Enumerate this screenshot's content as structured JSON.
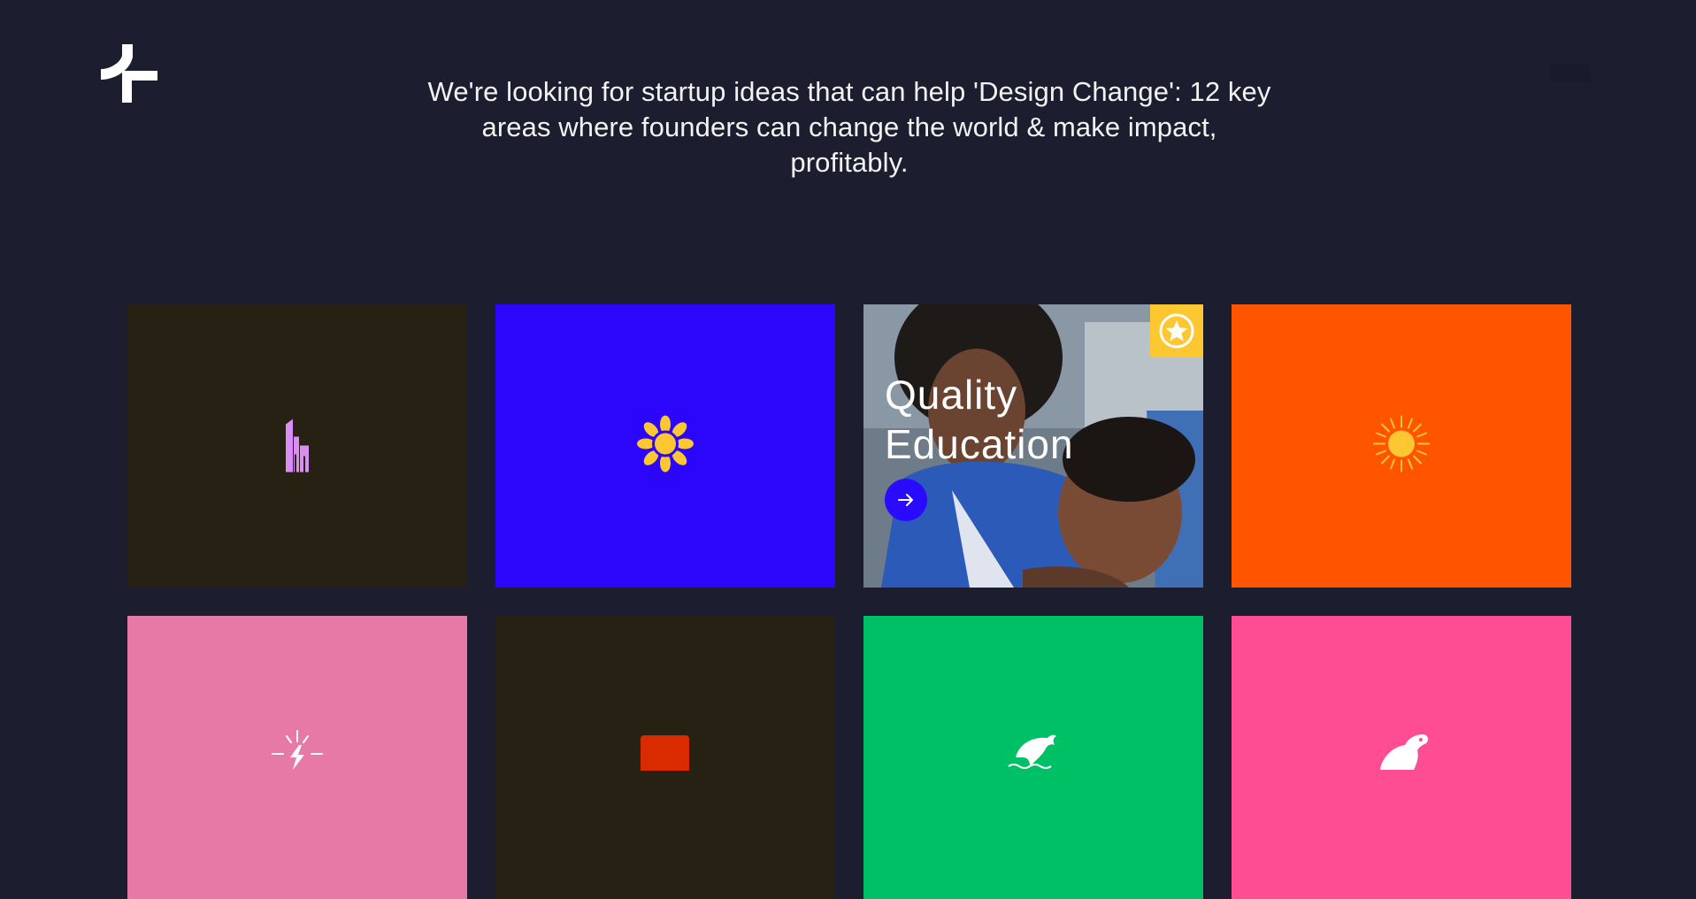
{
  "header": {
    "logo_icon": "fork-arrow-logo",
    "menu_icon": "menu-icon",
    "intro_text": "We're looking for startup ideas that can help 'Design Change': 12 key areas where founders can change the world & make impact, profitably."
  },
  "tiles": [
    {
      "color": "#262112",
      "icon": "city-buildings-icon",
      "icon_color": "#d98ef5"
    },
    {
      "color": "#2b06fb",
      "icon": "sunflower-icon",
      "icon_color": "#fcc731"
    },
    {
      "color": "#5d6c7c",
      "icon": "star-badge-icon",
      "badge_color": "#fcc731",
      "title_line1": "Quality",
      "title_line2": "Education",
      "button_icon": "arrow-right-icon",
      "button_color": "#2b0bff"
    },
    {
      "color": "#ff5500",
      "icon": "sun-icon",
      "icon_color": "#fcc731"
    },
    {
      "color": "#e779a7",
      "icon": "lightning-bolt-icon",
      "icon_color": "#ffffff"
    },
    {
      "color": "#262112",
      "icon": "red-block-icon",
      "icon_color": "#d92a00"
    },
    {
      "color": "#00c065",
      "icon": "dolphin-icon",
      "icon_color": "#ffffff"
    },
    {
      "color": "#ff4d93",
      "icon": "rabbit-icon",
      "icon_color": "#ffffff"
    }
  ]
}
